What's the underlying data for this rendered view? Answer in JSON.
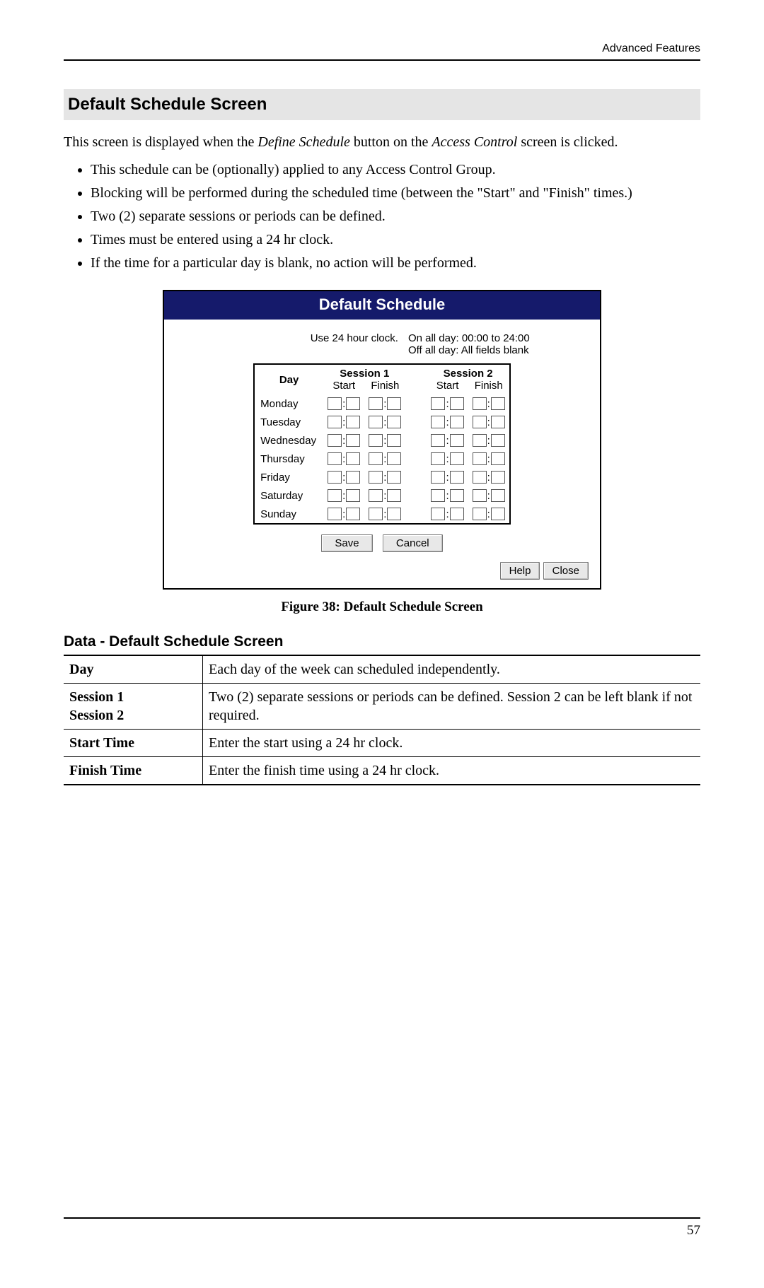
{
  "header": {
    "section": "Advanced Features"
  },
  "title": "Default Schedule Screen",
  "intro": {
    "pre": "This screen is displayed when the ",
    "em1": "Define Schedule",
    "mid": " button on the ",
    "em2": "Access Control",
    "post": " screen is clicked."
  },
  "bullets": [
    "This schedule can be (optionally) applied to any Access Control Group.",
    "Blocking will be performed during the scheduled time (between the \"Start\" and \"Finish\" times.)",
    "Two (2) separate sessions or periods can be defined.",
    "Times must be entered using a 24 hr clock.",
    "If the time for a particular day is blank, no action will be performed."
  ],
  "ui": {
    "title": "Default Schedule",
    "hint_left": "Use 24 hour clock.",
    "hint_right1": "On all day: 00:00 to 24:00",
    "hint_right2": "Off all day: All fields blank",
    "col_day": "Day",
    "col_session1": "Session 1",
    "col_session2": "Session 2",
    "col_start": "Start",
    "col_finish": "Finish",
    "days": [
      "Monday",
      "Tuesday",
      "Wednesday",
      "Thursday",
      "Friday",
      "Saturday",
      "Sunday"
    ],
    "btn_save": "Save",
    "btn_cancel": "Cancel",
    "btn_help": "Help",
    "btn_close": "Close"
  },
  "figure_caption": "Figure 38: Default Schedule Screen",
  "subhead": "Data - Default Schedule Screen",
  "data_table": [
    {
      "label": "Day",
      "desc": "Each day of the week can scheduled independently."
    },
    {
      "label": "Session 1\nSession 2",
      "desc": "Two (2) separate sessions or periods can be defined. Session 2 can be left blank if not required."
    },
    {
      "label": "Start Time",
      "desc": "Enter the start using a 24 hr clock."
    },
    {
      "label": "Finish Time",
      "desc": "Enter the finish time using a 24 hr clock."
    }
  ],
  "page_number": "57"
}
